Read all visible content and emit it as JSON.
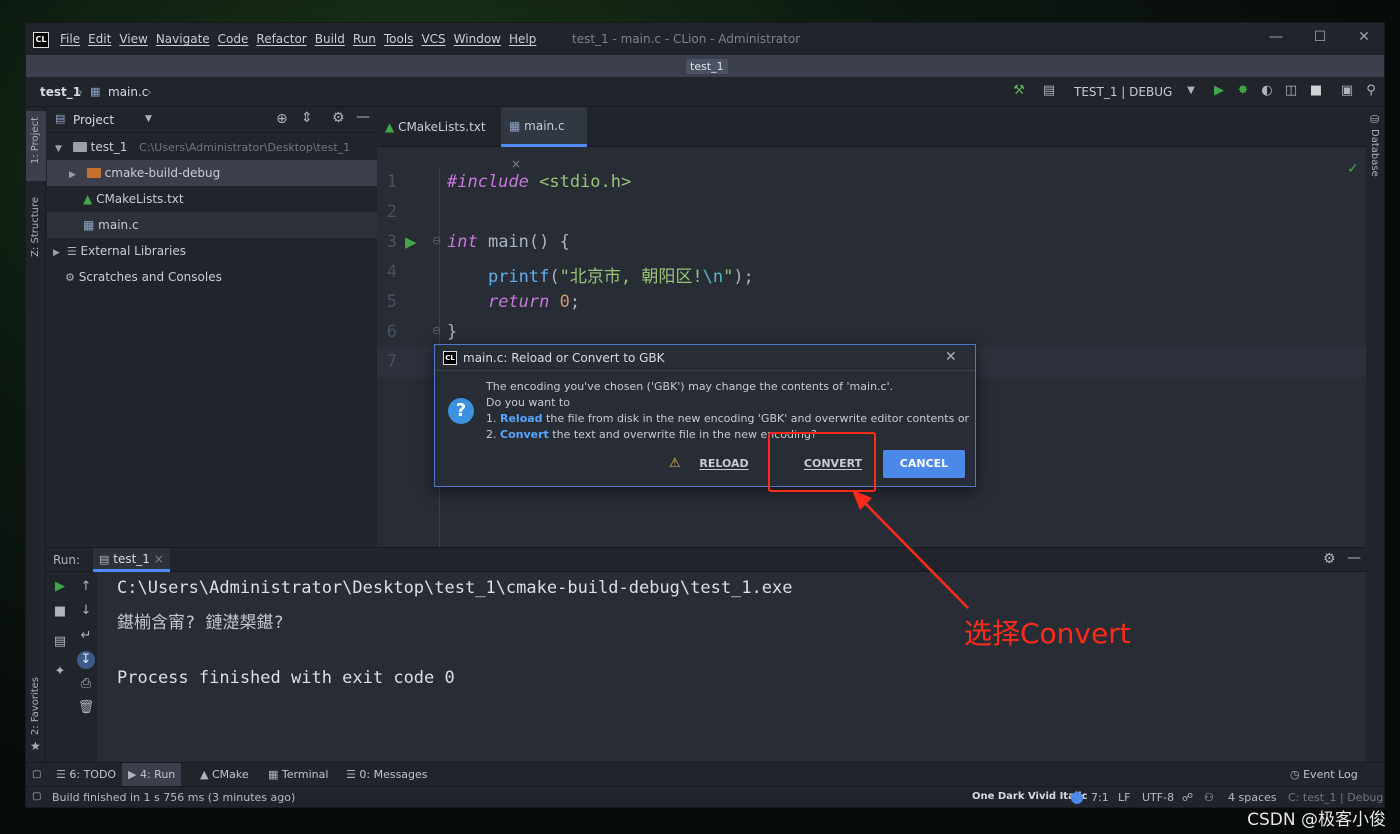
{
  "titlebar": {
    "logo": "CL",
    "menu": [
      "File",
      "Edit",
      "View",
      "Navigate",
      "Code",
      "Refactor",
      "Build",
      "Run",
      "Tools",
      "VCS",
      "Window",
      "Help"
    ],
    "title": "test_1 - main.c - CLion - Administrator",
    "controls": [
      "minimize-icon",
      "maximize-icon",
      "close-icon"
    ]
  },
  "project_tab": "test_1",
  "navbar": {
    "crumb_project": "test_1",
    "crumb_file": "main.c",
    "run_config": "TEST_1 | DEBUG"
  },
  "left_stripe": {
    "project_label": "1: Project",
    "structure_label": "Z: Structure",
    "favorites_label": "2: Favorites"
  },
  "right_stripe": {
    "database_label": "Database"
  },
  "project_panel": {
    "title": "Project",
    "tree": {
      "root_name": "test_1",
      "root_path": "C:\\Users\\Administrator\\Desktop\\test_1",
      "build_dir": "cmake-build-debug",
      "cmake_file": "CMakeLists.txt",
      "main_file": "main.c",
      "external_libs": "External Libraries",
      "scratches": "Scratches and Consoles"
    }
  },
  "editor": {
    "tabs": [
      "CMakeLists.txt",
      "main.c"
    ],
    "line_numbers": [
      "1",
      "2",
      "3",
      "4",
      "5",
      "6",
      "7"
    ],
    "code": {
      "l1_directive": "#include",
      "l1_header": " <stdio.h>",
      "l3_type": "int",
      "l3_rest": " main() {",
      "l4_indent": "    ",
      "l4_fn": "printf",
      "l4_open": "(",
      "l4_str": "\"北京市, 朝阳区!",
      "l4_esc": "\\n",
      "l4_close_str": "\"",
      "l4_end": ");",
      "l5_indent": "    ",
      "l5_kw": "return",
      "l5_num": " 0",
      "l5_end": ";",
      "l6": "}"
    }
  },
  "dialog": {
    "logo": "CL",
    "title": "main.c: Reload or Convert to GBK",
    "line1": "The encoding you've chosen ('GBK') may change the contents of 'main.c'.",
    "line2": "Do you want to",
    "line3_prefix": "1. ",
    "line3_bold": "Reload",
    "line3_rest": " the file from disk in the new encoding 'GBK' and overwrite editor contents or",
    "line4_prefix": "2. ",
    "line4_bold": "Convert",
    "line4_rest": " the text and overwrite file in the new encoding?",
    "reload_label": "RELOAD",
    "convert_label": "CONVERT",
    "cancel_label": "CANCEL"
  },
  "run_panel": {
    "label": "Run:",
    "tab": "test_1",
    "console": [
      "C:\\Users\\Administrator\\Desktop\\test_1\\cmake-build-debug\\test_1.exe",
      "鍖椾含甯? 鏈濋槼鍖?",
      "",
      "Process finished with exit code 0"
    ]
  },
  "tool_windows": [
    "6: TODO",
    "4: Run",
    "CMake",
    "Terminal",
    "0: Messages"
  ],
  "event_log": "Event Log",
  "status": {
    "message": "Build finished in 1 s 756 ms (3 minutes ago)",
    "theme": "One Dark Vivid Italic",
    "position": "7:1",
    "line_sep": "LF",
    "encoding": "UTF-8",
    "indent": "4 spaces",
    "context": "C: test_1 | Debug"
  },
  "annotation": {
    "text": "选择Convert",
    "color": "#ff2a1a"
  },
  "watermark": "CSDN @极客小俊",
  "colors": {
    "accent": "#528bff",
    "cancel_button": "#4c88e8",
    "run_green": "#3ea84a",
    "annotation_red": "#ff2a1a"
  }
}
